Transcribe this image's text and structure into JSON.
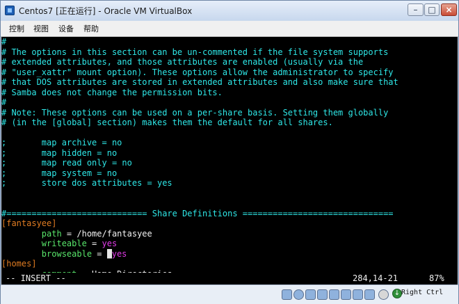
{
  "window": {
    "title": "Centos7 [正在运行] - Oracle VM VirtualBox"
  },
  "menu": [
    "控制",
    "视图",
    "设备",
    "帮助"
  ],
  "terminal": {
    "lines": [
      [
        {
          "t": "#",
          "c": "cyan"
        }
      ],
      [
        {
          "t": "# The options in this section can be un-commented if the file system supports",
          "c": "cyan"
        }
      ],
      [
        {
          "t": "# extended attributes, and those attributes are enabled (usually via the",
          "c": "cyan"
        }
      ],
      [
        {
          "t": "# \"user_xattr\" mount option). These options allow the administrator to specify",
          "c": "cyan"
        }
      ],
      [
        {
          "t": "# that DOS attributes are stored in extended attributes and also make sure that",
          "c": "cyan"
        }
      ],
      [
        {
          "t": "# Samba does not change the permission bits.",
          "c": "cyan"
        }
      ],
      [
        {
          "t": "#",
          "c": "cyan"
        }
      ],
      [
        {
          "t": "# Note: These options can be used on a per-share basis. Setting them globally",
          "c": "cyan"
        }
      ],
      [
        {
          "t": "# (in the [global] section) makes them the default for all shares.",
          "c": "cyan"
        }
      ],
      [
        {
          "t": "",
          "c": "cyan"
        }
      ],
      [
        {
          "t": ";       map archive = no",
          "c": "cyan"
        }
      ],
      [
        {
          "t": ";       map hidden = no",
          "c": "cyan"
        }
      ],
      [
        {
          "t": ";       map read only = no",
          "c": "cyan"
        }
      ],
      [
        {
          "t": ";       map system = no",
          "c": "cyan"
        }
      ],
      [
        {
          "t": ";       store dos attributes = yes",
          "c": "cyan"
        }
      ],
      [
        {
          "t": "",
          "c": "cyan"
        }
      ],
      [
        {
          "t": "",
          "c": "cyan"
        }
      ],
      [
        {
          "t": "#============================ Share Definitions ==============================",
          "c": "cyan"
        }
      ],
      [
        {
          "t": "[fantasyee]",
          "c": "orange"
        }
      ],
      [
        {
          "t": "        ",
          "c": "white"
        },
        {
          "t": "path",
          "c": "green"
        },
        {
          "t": " = /home/fantasyee",
          "c": "white"
        }
      ],
      [
        {
          "t": "        ",
          "c": "white"
        },
        {
          "t": "writeable",
          "c": "green"
        },
        {
          "t": " = ",
          "c": "white"
        },
        {
          "t": "yes",
          "c": "magenta"
        }
      ],
      [
        {
          "t": "        ",
          "c": "white"
        },
        {
          "t": "browseable",
          "c": "green"
        },
        {
          "t": " = ",
          "c": "white"
        },
        {
          "t": "_",
          "c": "cursor"
        },
        {
          "t": "yes",
          "c": "magenta"
        }
      ],
      [
        {
          "t": "[homes]",
          "c": "orange"
        }
      ],
      [
        {
          "t": "        ",
          "c": "white"
        },
        {
          "t": "comment",
          "c": "green"
        },
        {
          "t": " = Home Directories",
          "c": "white"
        }
      ]
    ],
    "mode": "-- INSERT --",
    "position": "284,14-21",
    "percent": "87%"
  },
  "statusbar": {
    "host_key": "Right Ctrl",
    "icons": [
      "hard-disk-icon",
      "optical-drive-icon",
      "usb-icon",
      "shared-folder-icon",
      "display-icon",
      "network-icon",
      "recording-icon",
      "mouse-integration-icon"
    ]
  }
}
